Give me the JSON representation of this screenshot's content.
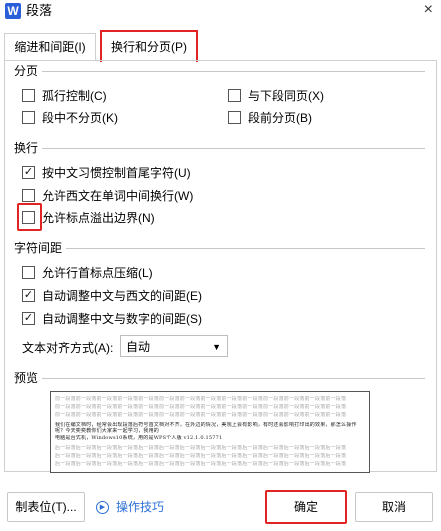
{
  "window": {
    "app_icon": "W",
    "title": "段落",
    "close": "×"
  },
  "tabs": [
    {
      "label": "缩进和间距(I)"
    },
    {
      "label": "换行和分页(P)"
    }
  ],
  "sections": {
    "pagination": {
      "title": "分页",
      "options": [
        {
          "label": "孤行控制(C)",
          "checked": false
        },
        {
          "label": "与下段同页(X)",
          "checked": false
        },
        {
          "label": "段中不分页(K)",
          "checked": false
        },
        {
          "label": "段前分页(B)",
          "checked": false
        }
      ]
    },
    "linebreak": {
      "title": "换行",
      "options": [
        {
          "label": "按中文习惯控制首尾字符(U)",
          "checked": true
        },
        {
          "label": "允许西文在单词中间换行(W)",
          "checked": false
        },
        {
          "label": "允许标点溢出边界(N)",
          "checked": false
        }
      ]
    },
    "spacing": {
      "title": "字符间距",
      "options": [
        {
          "label": "允许行首标点压缩(L)",
          "checked": false
        },
        {
          "label": "自动调整中文与西文的间距(E)",
          "checked": true
        },
        {
          "label": "自动调整中文与数字的间距(S)",
          "checked": true
        }
      ],
      "align_label": "文本对齐方式(A):",
      "align_value": "自动"
    },
    "preview": {
      "title": "预览",
      "prev_para": "前一段落前一段落前一段落前一段落前一段落前一段落前一段落前一段落前一段落前一段落前一段落前一段落前一段落前一段落",
      "sample_1": "我们在编文档时，经常会出现段落后符号首文档对不齐，在外边的情况，美观上会有影响，有时还会影响打印出的效果，那怎么操作呢？今天奕奕教你们大家来一起学习，我用的",
      "sample_2": "电脑是台式机，Windows10系统，用的是WPS个人版 v12.1.0.15771",
      "next_para": "后一段落后一段落后一段落后一段落后一段落后一段落后一段落后一段落后一段落后一段落后一段落后一段落后一段落后一段落"
    }
  },
  "footer": {
    "tabstops": "制表位(T)...",
    "tips": "操作技巧",
    "ok": "确定",
    "cancel": "取消"
  }
}
